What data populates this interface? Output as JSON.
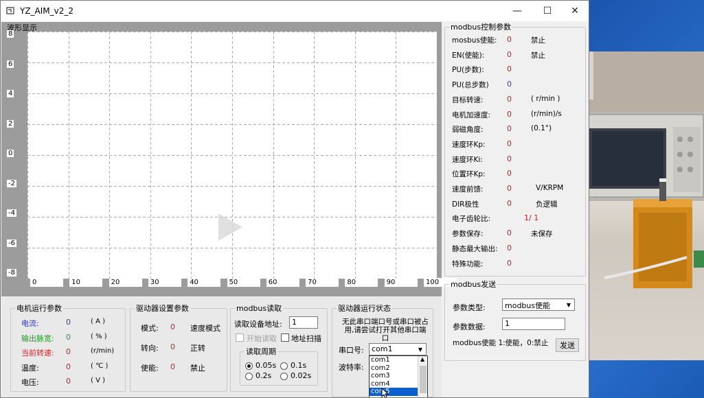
{
  "window": {
    "title": "YZ_AIM_v2_2",
    "minimize": "—",
    "maximize": "☐",
    "close": "✕"
  },
  "waveform": {
    "title": "波形显示",
    "y_ticks": [
      "8",
      "6",
      "4",
      "2",
      "0",
      "-2",
      "-4",
      "-6",
      "-8"
    ],
    "x_ticks": [
      "0",
      "10",
      "20",
      "30",
      "40",
      "50",
      "60",
      "70",
      "80",
      "90",
      "100"
    ],
    "y_range": [
      -8,
      8
    ],
    "x_range": [
      0,
      100
    ]
  },
  "modbus_params": {
    "title": "modbus控制参数",
    "rows": [
      {
        "label": "mosbus使能:",
        "value": "0",
        "unit": "禁止"
      },
      {
        "label": "EN(使能):",
        "value": "0",
        "unit": "禁止"
      },
      {
        "label": "PU(步数):",
        "value": "0",
        "unit": ""
      },
      {
        "label": "PU(总步数)",
        "value": "0",
        "unit": ""
      },
      {
        "label": "目标转速:",
        "value": "0",
        "unit": "( r/min )"
      },
      {
        "label": "电机加速度:",
        "value": "0",
        "unit": "(r/min)/s"
      },
      {
        "label": "弱磁角度:",
        "value": "0",
        "unit": "(0.1°)"
      },
      {
        "label": "速度环Kp:",
        "value": "0",
        "unit": ""
      },
      {
        "label": "速度环Ki:",
        "value": "0",
        "unit": ""
      },
      {
        "label": "位置环Kp:",
        "value": "0",
        "unit": ""
      },
      {
        "label": "速度前馈:",
        "value": "0",
        "unit": "V/KRPM"
      },
      {
        "label": "DIR极性",
        "value": "0",
        "unit": "负逻辑"
      },
      {
        "label": "电子齿轮比:",
        "value": "1/ 1",
        "unit": ""
      },
      {
        "label": "参数保存:",
        "value": "0",
        "unit": "未保存"
      },
      {
        "label": "静态最大输出:",
        "value": "0",
        "unit": ""
      },
      {
        "label": "特殊功能:",
        "value": "0",
        "unit": ""
      }
    ]
  },
  "modbus_send": {
    "title": "modbus发送",
    "type_label": "参数类型:",
    "type_value": "modbus使能",
    "data_label": "参数数据:",
    "data_value": "1",
    "hint": "modbus使能 1:使能，0:禁止",
    "send": "发送"
  },
  "motor_params": {
    "title": "电机运行参数",
    "rows": [
      {
        "label": "电流:",
        "value": "0",
        "unit": "( A )"
      },
      {
        "label": "输出脉宽:",
        "value": "0",
        "unit": "( % )"
      },
      {
        "label": "当前转速:",
        "value": "0",
        "unit": "(r/min)"
      },
      {
        "label": "温度:",
        "value": "0",
        "unit": "( ℃ )"
      },
      {
        "label": "电压:",
        "value": "0",
        "unit": "( V )"
      }
    ]
  },
  "driver_settings": {
    "title": "驱动器设置参数",
    "rows": [
      {
        "label": "模式:",
        "value": "0",
        "unit": "速度模式"
      },
      {
        "label": "转向:",
        "value": "0",
        "unit": "正转"
      },
      {
        "label": "使能:",
        "value": "0",
        "unit": "禁止"
      }
    ]
  },
  "modbus_read": {
    "title": "modbus读取",
    "addr_label": "读取设备地址:",
    "addr_value": "1",
    "start_read": "开始读取",
    "addr_scan": "地址扫描",
    "period_title": "读取周期",
    "opt1": "0.05s",
    "opt2": "0.1s",
    "opt3": "0.2s",
    "opt4": "0.02s"
  },
  "driver_status": {
    "title": "驱动器运行状态",
    "message": "无此串口端口号或串口被占用,请尝试打开其他串口端口",
    "port_label": "串口号:",
    "port_value": "com1",
    "baud_label": "波特率:",
    "port_options": [
      "com1",
      "com2",
      "com3",
      "com4",
      "com5"
    ]
  }
}
